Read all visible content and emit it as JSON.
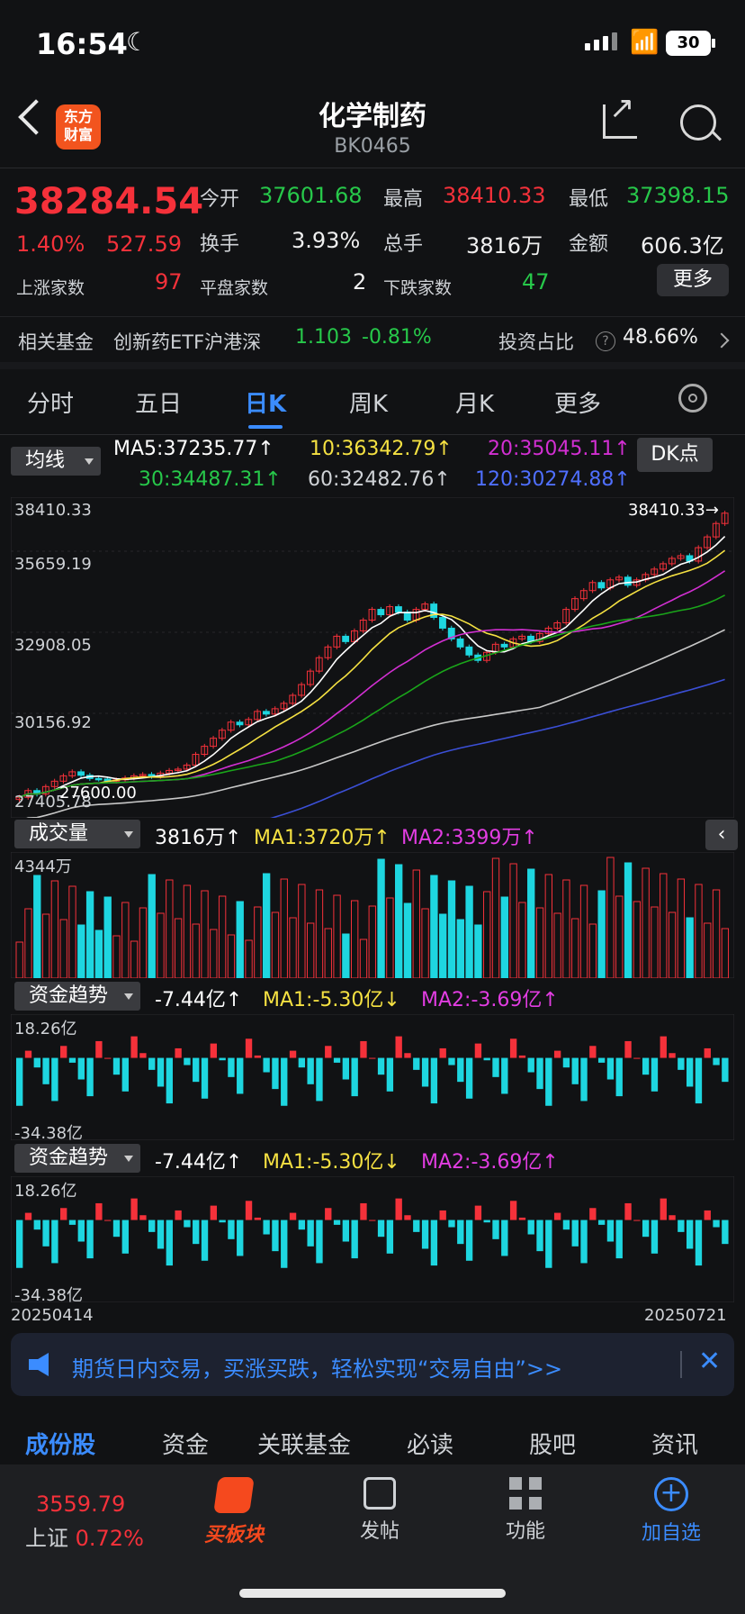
{
  "status": {
    "time": "16:54",
    "battery": "30"
  },
  "header": {
    "logo_line1": "东方",
    "logo_line2": "财富",
    "title": "化学制药",
    "code": "BK0465"
  },
  "quote": {
    "price": "38284.54",
    "change_pct": "1.40%",
    "change": "527.59",
    "open_label": "今开",
    "open": "37601.68",
    "high_label": "最高",
    "high": "38410.33",
    "low_label": "最低",
    "low": "37398.15",
    "turnover_label": "换手",
    "turnover": "3.93%",
    "volume_label": "总手",
    "volume": "3816万",
    "amount_label": "金额",
    "amount": "606.3亿",
    "up_label": "上涨家数",
    "up_count": "97",
    "flat_label": "平盘家数",
    "flat_count": "2",
    "down_label": "下跌家数",
    "down_count": "47",
    "more_button": "更多"
  },
  "fund": {
    "label": "相关基金",
    "name": "创新药ETF沪港深",
    "value": "1.103",
    "pct": "-0.81%",
    "ratio_label": "投资占比",
    "ratio": "48.66%"
  },
  "tabs": [
    "分时",
    "五日",
    "日K",
    "周K",
    "月K",
    "更多"
  ],
  "active_tab": "日K",
  "ma": {
    "selector": "均线",
    "ma5": "MA5:37235.77↑",
    "ma10": "10:36342.79↑",
    "ma20": "20:35045.11↑",
    "ma30": "30:34487.31↑",
    "ma60": "60:32482.76↑",
    "ma120": "120:30274.88↑",
    "dk_button": "DK点",
    "colors": {
      "ma5": "#ffffff",
      "ma10": "#f5e142",
      "ma20": "#d22fd2",
      "ma30": "#1aa51a",
      "ma60": "#c8c8c8",
      "ma120": "#3b4fd6"
    }
  },
  "chart_axis": {
    "y1": "38410.33",
    "y2": "35659.19",
    "y3": "32908.05",
    "y4": "30156.92",
    "y5": "27405.78",
    "high_marker": "38410.33→",
    "low_marker": "27600.00"
  },
  "volume": {
    "selector": "成交量",
    "value": "3816万↑",
    "ma1": "MA1:3720万↑",
    "ma2": "MA2:3399万↑",
    "max": "4344万"
  },
  "fund_trend": {
    "selector": "资金趋势",
    "value": "-7.44亿↑",
    "ma1": "MA1:-5.30亿↓",
    "ma2": "MA2:-3.69亿↑",
    "max": "18.26亿",
    "min": "-34.38亿"
  },
  "dates": {
    "start": "20250414",
    "end": "20250721"
  },
  "banner": {
    "text": "期货日内交易，买涨买跌，轻松实现“交易自由”>>"
  },
  "bottom_tabs": [
    "成份股",
    "资金",
    "关联基金",
    "必读",
    "股吧",
    "资讯"
  ],
  "nav": {
    "index_value": "3559.79",
    "index_name": "上证",
    "index_pct": "0.72%",
    "board": "买板块",
    "post": "发帖",
    "func": "功能",
    "add": "加自选"
  },
  "chart_data": {
    "type": "candlestick",
    "x_range": [
      "20250414",
      "20250721"
    ],
    "ylim": [
      27405.78,
      38410.33
    ],
    "y_ticks": [
      38410.33,
      35659.19,
      32908.05,
      30156.92,
      27405.78
    ],
    "close": [
      27700,
      27950,
      27820,
      28100,
      28300,
      28500,
      28650,
      28520,
      28400,
      28380,
      28300,
      28350,
      28420,
      28500,
      28550,
      28480,
      28600,
      28700,
      28750,
      28900,
      29300,
      29600,
      29900,
      30200,
      30500,
      30400,
      30600,
      30900,
      30800,
      31000,
      31200,
      31500,
      31900,
      32400,
      32900,
      33300,
      33700,
      33500,
      33900,
      34300,
      34700,
      34500,
      34800,
      34600,
      34300,
      34700,
      34900,
      34400,
      34000,
      33600,
      33300,
      33000,
      32800,
      33100,
      33400,
      33300,
      33600,
      33700,
      33500,
      33800,
      34000,
      34200,
      34700,
      35100,
      35400,
      35700,
      35500,
      35800,
      35900,
      35600,
      35800,
      36000,
      36200,
      36400,
      36600,
      36700,
      36500,
      37000,
      37400,
      37900,
      38284.54
    ],
    "volume_max": "4344万",
    "fund_range": [
      -34.38,
      18.26
    ]
  }
}
